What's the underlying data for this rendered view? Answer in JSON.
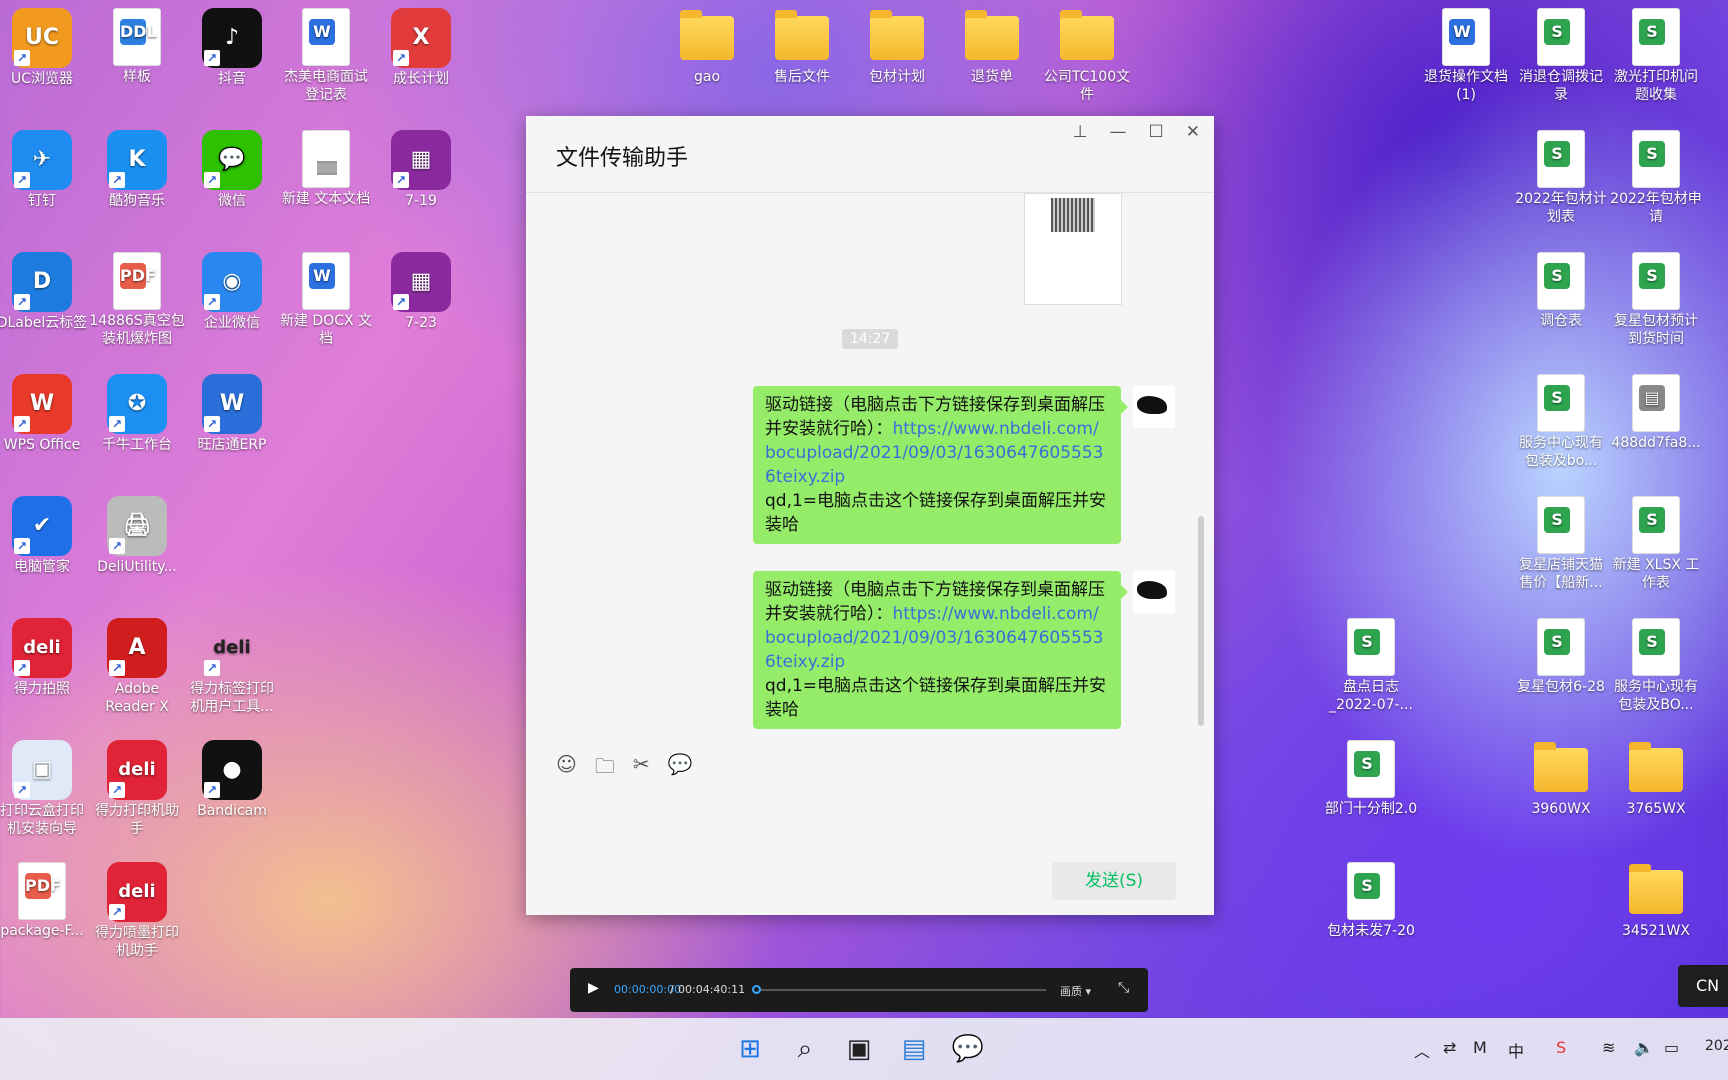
{
  "desktop": {
    "left_col1": [
      {
        "label": "UC浏览器",
        "glyph": "UC",
        "color": "#f29a1f",
        "icon": "uc-browser-icon"
      },
      {
        "label": "钉钉",
        "glyph": "✈",
        "color": "#1e8cf0",
        "icon": "dingtalk-icon"
      },
      {
        "label": "DLabel云标签",
        "glyph": "D",
        "color": "#1e7be0",
        "icon": "dlabel-icon"
      },
      {
        "label": "WPS Office",
        "glyph": "W",
        "color": "#e8392b",
        "icon": "wps-icon"
      },
      {
        "label": "电脑管家",
        "glyph": "✔",
        "color": "#1f6fe8",
        "icon": "pc-manager-icon"
      },
      {
        "label": "得力拍照",
        "glyph": "deli",
        "color": "#e02336",
        "icon": "deli-photo-icon"
      },
      {
        "label": "打印云盒打印机安装向导",
        "glyph": "▣",
        "color": "#dfe9f7",
        "icon": "print-box-icon"
      },
      {
        "label": "package-F...",
        "glyph": "PDF",
        "color": "#e85d4a",
        "icon": "pdf-file-icon"
      }
    ],
    "left_col2": [
      {
        "label": "样板",
        "glyph": "DDL",
        "color": "#2d7fe0",
        "icon": "ddl-file-icon"
      },
      {
        "label": "酷狗音乐",
        "glyph": "K",
        "color": "#1a8ff0",
        "icon": "kugou-icon"
      },
      {
        "label": "14886S真空包装机爆炸图",
        "glyph": "PDF",
        "color": "#e85d4a",
        "icon": "pdf-file-icon"
      },
      {
        "label": "千牛工作台",
        "glyph": "✪",
        "color": "#1c8ff2",
        "icon": "qianniu-icon"
      },
      {
        "label": "DeliUtility...",
        "glyph": "🖨",
        "color": "#bbbbbb",
        "icon": "printer-icon"
      },
      {
        "label": "Adobe Reader X",
        "glyph": "A",
        "color": "#d01e1e",
        "icon": "adobe-reader-icon"
      },
      {
        "label": "得力打印机助手",
        "glyph": "deli",
        "color": "#e02336",
        "icon": "deli-printer-icon"
      },
      {
        "label": "得力喷墨打印机助手",
        "glyph": "deli",
        "color": "#e02336",
        "icon": "deli-inkjet-icon"
      }
    ],
    "left_col3": [
      {
        "label": "抖音",
        "glyph": "♪",
        "color": "#111111",
        "icon": "douyin-icon"
      },
      {
        "label": "微信",
        "glyph": "💬",
        "color": "#2dc100",
        "icon": "wechat-icon"
      },
      {
        "label": "企业微信",
        "glyph": "◉",
        "color": "#2b87f0",
        "icon": "wecom-icon"
      },
      {
        "label": "旺店通ERP",
        "glyph": "W",
        "color": "#2a6fd9",
        "icon": "wangdiantong-icon"
      },
      {
        "label": "得力标签打印机用户工具...",
        "glyph": "deli",
        "color": "#ffffff",
        "icon": "deli-label-icon"
      },
      {
        "label": "Bandicam",
        "glyph": "●",
        "color": "#111111",
        "icon": "bandicam-icon"
      }
    ],
    "left_col4": [
      {
        "label": "杰美电商面试登记表",
        "glyph": "W",
        "color": "#2b6fe0",
        "icon": "word-doc-icon"
      },
      {
        "label": "新建 文本文档",
        "glyph": "",
        "color": "#aaaaaa",
        "icon": "text-doc-icon"
      },
      {
        "label": "新建 DOCX 文档",
        "glyph": "W",
        "color": "#2b6fe0",
        "icon": "word-doc-icon"
      }
    ],
    "left_col5": [
      {
        "label": "成长计划",
        "glyph": "X",
        "color": "#e23b3b",
        "icon": "xmind-icon"
      },
      {
        "label": "7-19",
        "glyph": "▦",
        "color": "#8a2a9e",
        "icon": "winrar-icon"
      },
      {
        "label": "7-23",
        "glyph": "▦",
        "color": "#8a2a9e",
        "icon": "winrar-icon"
      }
    ],
    "top_folders": [
      "gao",
      "售后文件",
      "包材计划",
      "退货单",
      "公司TC100文件"
    ],
    "right_col_a": [
      {
        "label": "退货操作文档(1)",
        "glyph": "W",
        "color": "#2b6fe0",
        "icon": "word-doc-icon"
      }
    ],
    "right_col_b": [
      {
        "label": "消退仓调拨记录",
        "glyph": "S",
        "color": "#2ea44f",
        "icon": "spreadsheet-icon"
      },
      {
        "label": "2022年包材计划表",
        "glyph": "S",
        "color": "#2ea44f",
        "icon": "spreadsheet-icon"
      },
      {
        "label": "调仓表",
        "glyph": "S",
        "color": "#2ea44f",
        "icon": "spreadsheet-icon"
      },
      {
        "label": "服务中心现有包装及bo...",
        "glyph": "S",
        "color": "#2ea44f",
        "icon": "spreadsheet-icon"
      },
      {
        "label": "复星店铺天猫售价【船新...",
        "glyph": "S",
        "color": "#2ea44f",
        "icon": "spreadsheet-icon"
      },
      {
        "label": "复星包材6-28",
        "glyph": "S",
        "color": "#2ea44f",
        "icon": "spreadsheet-icon"
      },
      {
        "label": "3960WX",
        "glyph": "",
        "color": "#f4b72d",
        "icon": "folder-icon"
      }
    ],
    "right_col_c": [
      {
        "label": "激光打印机问题收集",
        "glyph": "S",
        "color": "#2ea44f",
        "icon": "spreadsheet-icon"
      },
      {
        "label": "2022年包材申请",
        "glyph": "S",
        "color": "#2ea44f",
        "icon": "spreadsheet-icon"
      },
      {
        "label": "复星包材预计到货时间",
        "glyph": "S",
        "color": "#2ea44f",
        "icon": "spreadsheet-icon"
      },
      {
        "label": "488dd7fa8...",
        "glyph": "▤",
        "color": "#888888",
        "icon": "image-file-icon"
      },
      {
        "label": "新建 XLSX 工作表",
        "glyph": "S",
        "color": "#2ea44f",
        "icon": "spreadsheet-icon"
      },
      {
        "label": "服务中心现有包装及BO...",
        "glyph": "S",
        "color": "#2ea44f",
        "icon": "spreadsheet-icon"
      },
      {
        "label": "3765WX",
        "glyph": "",
        "color": "#f4b72d",
        "icon": "folder-icon"
      },
      {
        "label": "34521WX",
        "glyph": "",
        "color": "#f4b72d",
        "icon": "folder-icon"
      }
    ],
    "right_col_d": [
      {
        "label": "盘点日志_2022-07-...",
        "glyph": "S",
        "color": "#2ea44f",
        "icon": "spreadsheet-icon"
      },
      {
        "label": "部门十分制2.0",
        "glyph": "S",
        "color": "#2ea44f",
        "icon": "spreadsheet-icon"
      },
      {
        "label": "包材未发7-20",
        "glyph": "S",
        "color": "#2ea44f",
        "icon": "spreadsheet-icon"
      }
    ]
  },
  "chat": {
    "title": "文件传输助手",
    "controls": [
      "pin-icon",
      "minimize-icon",
      "maximize-icon",
      "close-icon"
    ],
    "timestamp": "14:27",
    "messages": [
      {
        "text": "驱动链接（电脑点击下方链接保存到桌面解压并安装就行哈）：",
        "link": "https://www.nbdeli.com/bocupload/2021/09/03/16306476055536teixy.zip",
        "after": "qd,1=电脑点击这个链接保存到桌面解压并安装哈"
      },
      {
        "text": "驱动链接（电脑点击下方链接保存到桌面解压并安装就行哈）：",
        "link": "https://www.nbdeli.com/bocupload/2021/09/03/16306476055536teixy.zip",
        "after": "qd,1=电脑点击这个链接保存到桌面解压并安装哈"
      }
    ],
    "toolbar": [
      "emoji-icon",
      "folder-icon",
      "scissors-icon",
      "chat-history-icon"
    ],
    "send_label": "发送(S)"
  },
  "media": {
    "current": "00:00:00:00",
    "separator": "/",
    "total": "00:04:40:11",
    "quality": "画质",
    "progress": 0
  },
  "ime": "CN",
  "taskbar": {
    "apps": [
      "windows-start-icon",
      "search-icon",
      "task-view-icon",
      "control-panel-icon",
      "wechat-icon"
    ],
    "clock": "202"
  }
}
